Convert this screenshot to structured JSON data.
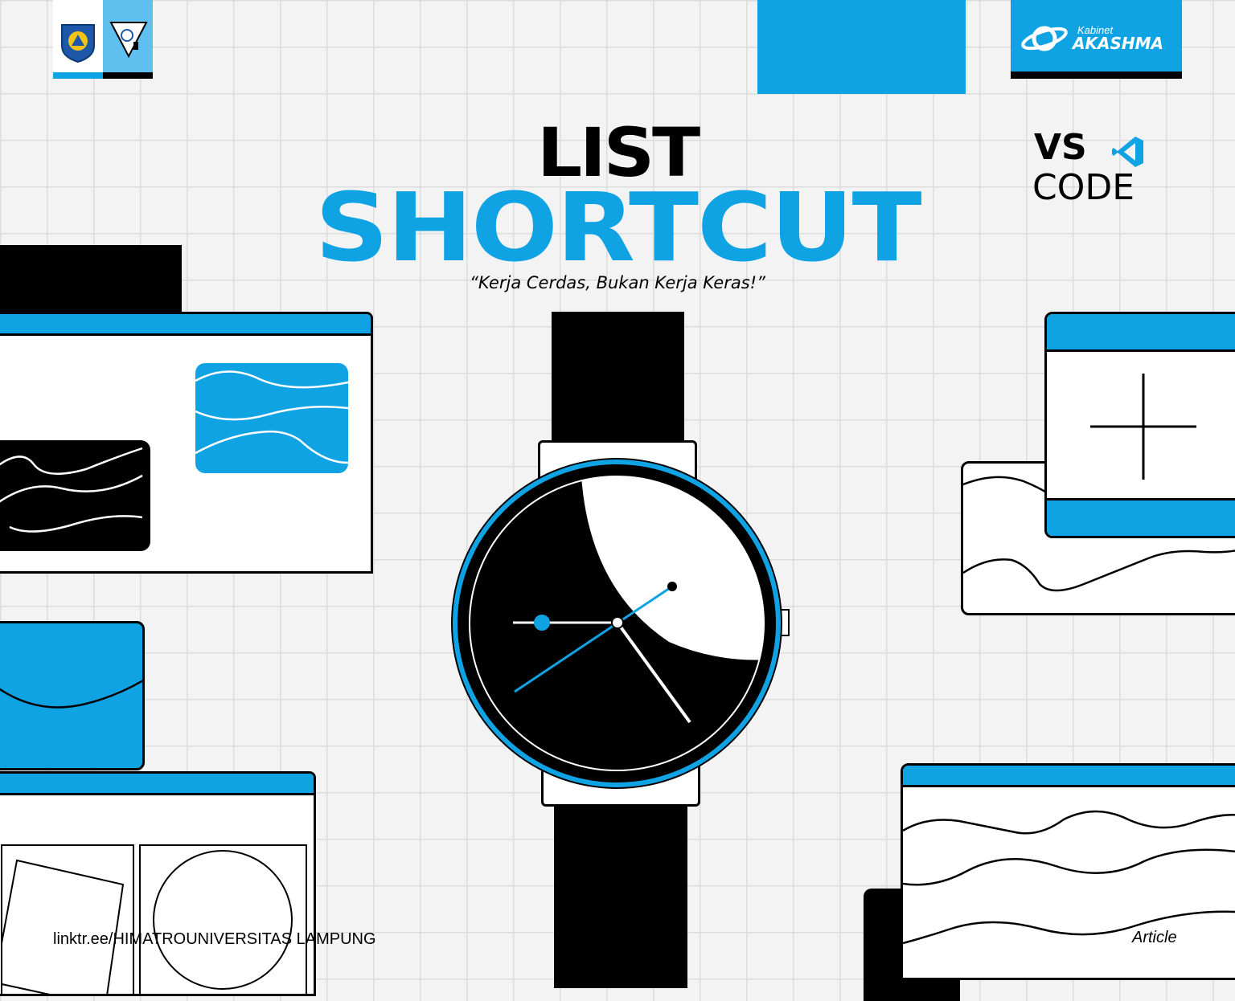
{
  "header": {
    "title_line1": "LIST",
    "title_line2": "SHORTCUT",
    "tagline": "“Kerja Cerdas, Bukan Kerja Keras!”"
  },
  "logos": {
    "university_seal": "universitas-lampung-logo",
    "himatro_emblem": "himatro-logo",
    "kabinet_small": "Kabinet",
    "kabinet_name": "AKASHMA"
  },
  "vscode": {
    "line1": "VS",
    "line2": "CODE",
    "icon": "vscode-icon"
  },
  "footer": {
    "link": "linktr.ee/HIMATROUNIVERSITAS LAMPUNG",
    "label": "Article"
  },
  "colors": {
    "accent": "#10a3e4",
    "dark": "#000000",
    "paper": "#f3f3f3"
  }
}
